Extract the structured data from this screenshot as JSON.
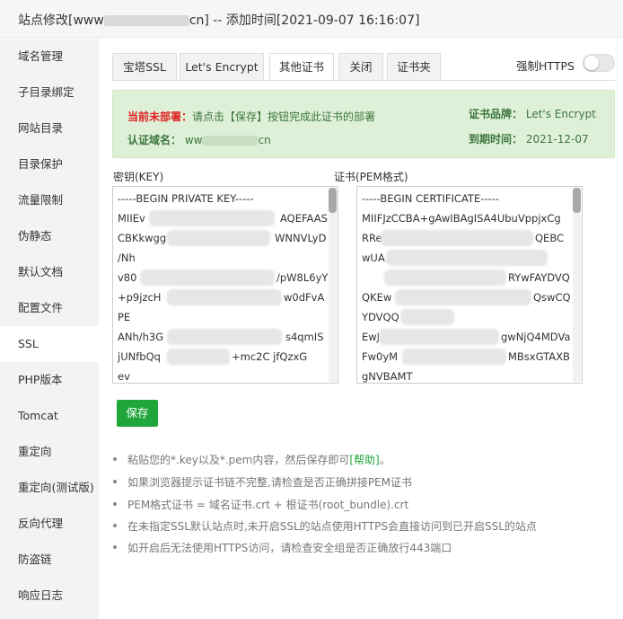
{
  "titlebar": {
    "title_prefix": "站点修改[www",
    "title_suffix": "cn] -- 添加时间[2021-09-07 16:16:07]"
  },
  "sidebar": {
    "items": [
      {
        "label": "域名管理"
      },
      {
        "label": "子目录绑定"
      },
      {
        "label": "网站目录"
      },
      {
        "label": "目录保护"
      },
      {
        "label": "流量限制"
      },
      {
        "label": "伪静态"
      },
      {
        "label": "默认文档"
      },
      {
        "label": "配置文件"
      },
      {
        "label": "SSL"
      },
      {
        "label": "PHP版本"
      },
      {
        "label": "Tomcat"
      },
      {
        "label": "重定向"
      },
      {
        "label": "重定向(测试版)"
      },
      {
        "label": "反向代理"
      },
      {
        "label": "防盗链"
      },
      {
        "label": "响应日志"
      }
    ],
    "active_index": 8
  },
  "tabs": [
    {
      "label": "宝塔SSL"
    },
    {
      "label": "Let's Encrypt"
    },
    {
      "label": "其他证书"
    },
    {
      "label": "关闭"
    },
    {
      "label": "证书夹"
    }
  ],
  "https_toggle": {
    "label": "强制HTTPS",
    "enabled": false
  },
  "info": {
    "status_label": "当前未部署：",
    "status_text": "请点击【保存】按钮完成此证书的部署",
    "domain_label": "认证域名：",
    "domain_prefix": "ww",
    "domain_suffix": "cn",
    "brand_label": "证书品牌：",
    "brand_value": "Let's Encrypt",
    "expiry_label": "到期时间：",
    "expiry_value": "2021-12-07"
  },
  "key_field": {
    "label": "密钥(KEY)",
    "lines": [
      "-----BEGIN PRIVATE KEY-----",
      "MIIEv",
      "CBKkwgg",
      "/Nh",
      "v80",
      "+p9jzcH",
      "PE",
      "ANh/h3G",
      "jUNfbQq",
      "ev"
    ],
    "right_fragments": [
      "",
      "AQEFAAS",
      "WNNVLyD",
      "",
      "/pW8L6yY",
      "w0dFvA",
      "",
      "s4qmIS",
      "+mc2C  jfQzxG",
      ""
    ]
  },
  "cert_field": {
    "label": "证书(PEM格式)",
    "lines": [
      "-----BEGIN CERTIFICATE-----",
      "MIIFJzCCBA+gAwIBAgISA4UbuVppjxCg",
      "RRe",
      "wUA",
      "",
      "QKEw",
      "YDVQQ",
      "EwJ",
      "Fw0yM",
      "gNVBAMT"
    ],
    "right_fragments": [
      "",
      "",
      "QEBC",
      "",
      "RYwFAYDVQ",
      "QswCQ",
      "",
      "gwNjQ4MDVa",
      "MBsxGTAXB",
      ""
    ]
  },
  "save_button": {
    "label": "保存"
  },
  "tips": [
    {
      "text": "粘贴您的*.key以及*.pem内容，然后保存即可",
      "link": "[帮助]",
      "tail": "。"
    },
    {
      "text": "如果浏览器提示证书链不完整,请检查是否正确拼接PEM证书"
    },
    {
      "text": "PEM格式证书 = 域名证书.crt + 根证书(root_bundle).crt"
    },
    {
      "text": "在未指定SSL默认站点时,未开启SSL的站点使用HTTPS会直接访问到已开启SSL的站点"
    },
    {
      "text": "如开启后无法使用HTTPS访问，请检查安全组是否正确放行443端口"
    }
  ]
}
